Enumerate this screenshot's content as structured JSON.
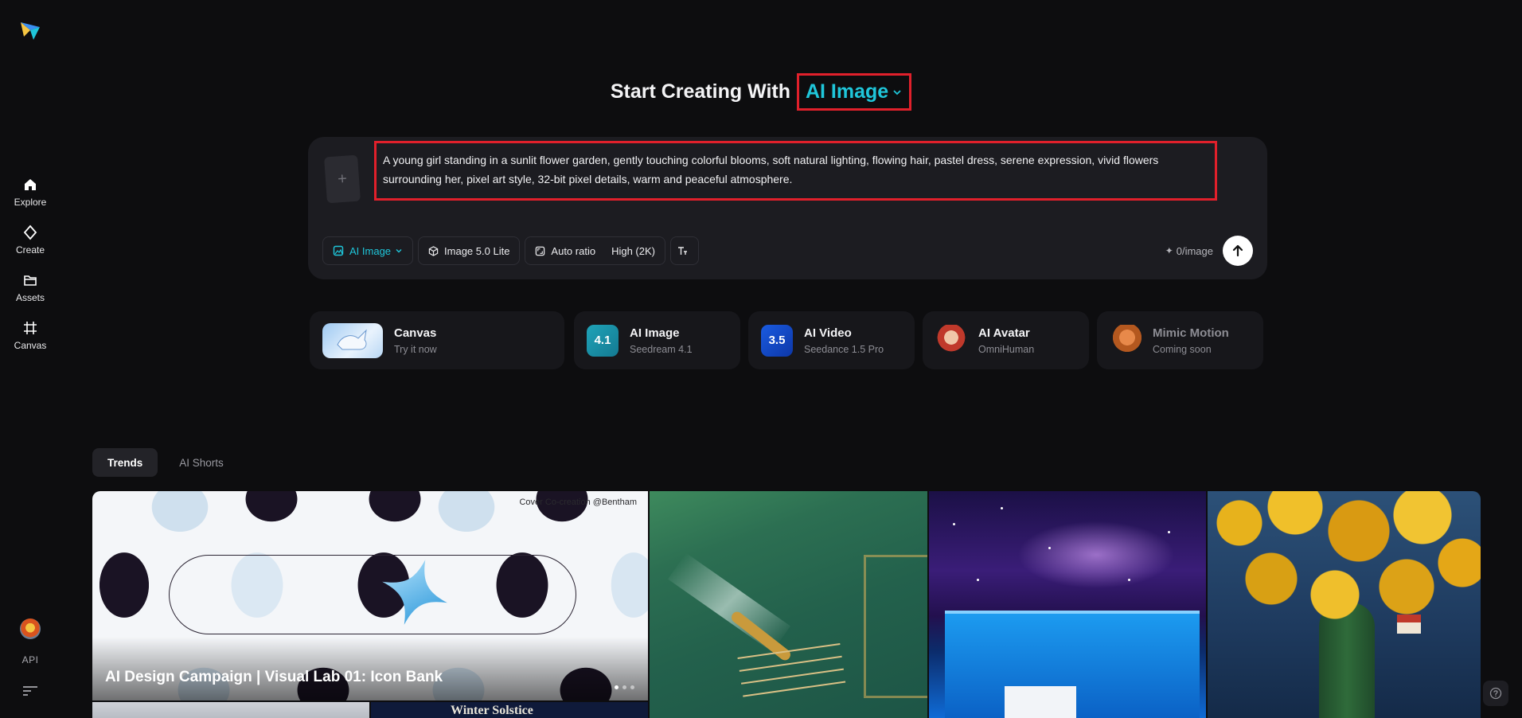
{
  "sidebar": {
    "items": [
      {
        "label": "Explore"
      },
      {
        "label": "Create"
      },
      {
        "label": "Assets"
      },
      {
        "label": "Canvas"
      }
    ],
    "api_label": "API"
  },
  "headline": {
    "lead": "Start Creating With",
    "mode": "AI Image"
  },
  "prompt": {
    "text": "A young girl standing in a sunlit flower garden, gently touching colorful blooms, soft natural lighting, flowing hair, pastel dress, serene expression, vivid flowers surrounding her, pixel art style, 32-bit pixel details, warm and peaceful atmosphere."
  },
  "toolbar": {
    "mode_chip": "AI Image",
    "model_chip": "Image 5.0 Lite",
    "ratio": "Auto ratio",
    "quality": "High (2K)",
    "credits": "0/image"
  },
  "cards": [
    {
      "title": "Canvas",
      "subtitle": "Try it now"
    },
    {
      "title": "AI Image",
      "subtitle": "Seedream 4.1",
      "badge": "4.1"
    },
    {
      "title": "AI Video",
      "subtitle": "Seedance 1.5 Pro",
      "badge": "3.5"
    },
    {
      "title": "AI Avatar",
      "subtitle": "OmniHuman"
    },
    {
      "title": "Mimic Motion",
      "subtitle": "Coming soon"
    }
  ],
  "tabs": [
    {
      "label": "Trends",
      "active": true
    },
    {
      "label": "AI Shorts",
      "active": false
    }
  ],
  "gallery": {
    "featured_caption": "AI Design Campaign | Visual Lab 01: Icon Bank",
    "featured_credit": "Cover Co-creation @Bentham",
    "row2_title_partial": "Winter Solstice"
  },
  "colors": {
    "accent": "#1fc6da",
    "highlight_border": "#e0202b",
    "background": "#0d0d0f",
    "panel": "#1c1c21"
  }
}
